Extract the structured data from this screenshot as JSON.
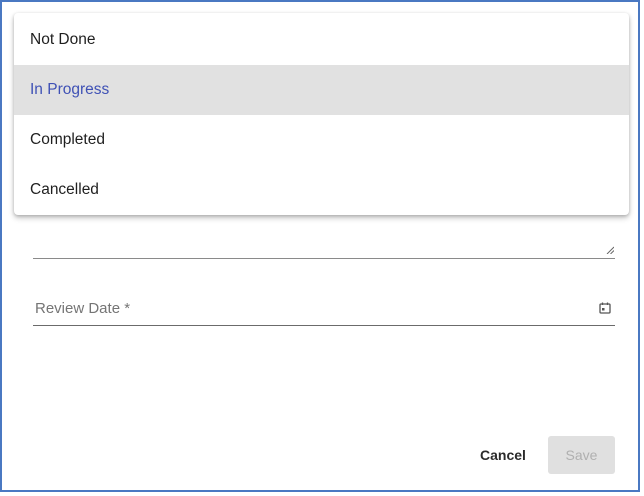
{
  "status_menu": {
    "options": [
      {
        "label": "Not Done",
        "selected": false
      },
      {
        "label": "In Progress",
        "selected": true
      },
      {
        "label": "Completed",
        "selected": false
      },
      {
        "label": "Cancelled",
        "selected": false
      }
    ]
  },
  "form": {
    "review_date_label": "Review Date *",
    "notes_value": ""
  },
  "footer": {
    "cancel_label": "Cancel",
    "save_label": "Save"
  },
  "colors": {
    "frame_border": "#4a78c2",
    "selected_text": "#3f51b5",
    "selected_bg": "#e1e1e1",
    "save_disabled_bg": "#e0e0e0",
    "save_disabled_text": "#b0b0b0"
  },
  "icons": {
    "date": "calendar-icon",
    "resize": "resize-handle-icon"
  }
}
